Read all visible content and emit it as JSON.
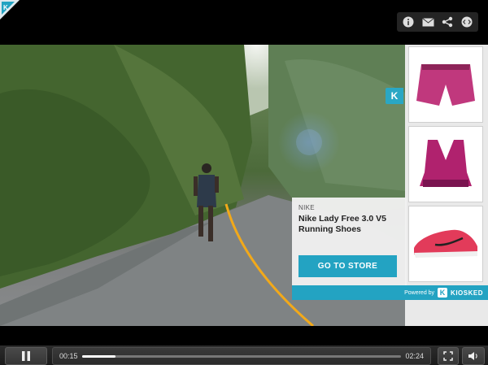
{
  "player": {
    "current_time": "00:15",
    "duration": "02:24",
    "progress": 0.104,
    "state": "playing"
  },
  "top_bar": {
    "icons": [
      "info-icon",
      "mail-icon",
      "share-icon",
      "embed-icon"
    ]
  },
  "product_strip": {
    "badge": "K",
    "items": [
      {
        "icon": "shorts-icon",
        "color": "#c0387d"
      },
      {
        "icon": "sports-bra-icon",
        "color": "#b0226e"
      },
      {
        "icon": "shoe-icon",
        "color": "#e23b5a"
      }
    ]
  },
  "popup": {
    "brand": "NIKE",
    "product_name": "Nike Lady Free 3.0 V5 Running Shoes",
    "button_label": "GO TO STORE",
    "powered_by": "Powered by",
    "provider": "KIOSKED"
  },
  "colors": {
    "accent": "#23a3c2",
    "control_bar": "#2c2c2c"
  }
}
